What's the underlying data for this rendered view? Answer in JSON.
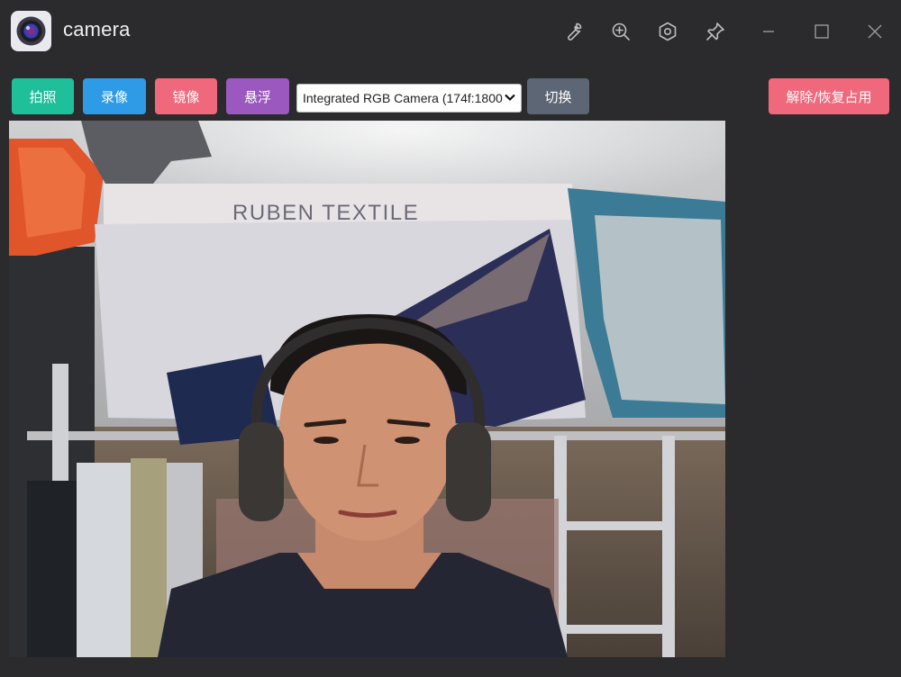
{
  "window": {
    "title": "camera"
  },
  "icons": {
    "app": "camera-lens-icon",
    "wrench": "wrench-icon",
    "zoom": "zoom-in-icon",
    "settings": "hexagon-settings-icon",
    "pin": "pin-icon",
    "minimize": "minimize-icon",
    "maximize": "maximize-icon",
    "close": "close-icon"
  },
  "toolbar": {
    "photo_label": "拍照",
    "record_label": "录像",
    "mirror_label": "镜像",
    "float_label": "悬浮",
    "switch_label": "切换",
    "release_label": "解除/恢复占用",
    "camera_select": {
      "selected": "Integrated RGB Camera (174f:1800)"
    }
  },
  "colors": {
    "photo": "#1fbf9a",
    "record": "#2f9be6",
    "mirror": "#f0687c",
    "float": "#9b59c0",
    "switch": "#5d6674",
    "release": "#f0687c",
    "background": "#2b2b2d"
  },
  "preview": {
    "banner_text": "RUBEN TEXTILE"
  }
}
